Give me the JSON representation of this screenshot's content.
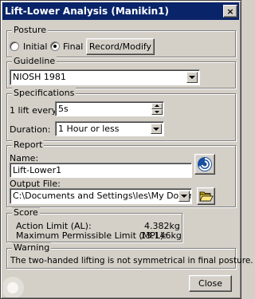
{
  "window": {
    "title": "Lift-Lower Analysis (Manikin1)",
    "close_glyph": "×"
  },
  "posture": {
    "group_label": "Posture",
    "options": [
      {
        "label": "Initial",
        "selected": false
      },
      {
        "label": "Final",
        "selected": true
      }
    ],
    "record_button": "Record/Modify"
  },
  "guideline": {
    "group_label": "Guideline",
    "selected": "NIOSH 1981"
  },
  "specifications": {
    "group_label": "Specifications",
    "lift_every_label": "1 lift every:",
    "lift_every_value": "5s",
    "duration_label": "Duration:",
    "duration_value": "1 Hour or less"
  },
  "report": {
    "group_label": "Report",
    "name_label": "Name:",
    "name_value": "Lift-Lower1",
    "output_file_label": "Output File:",
    "output_file_value": "C:\\Documents and Settings\\les\\My Docum",
    "icons": [
      "report-swirl-icon",
      "open-folder-icon"
    ]
  },
  "score": {
    "group_label": "Score",
    "rows": [
      {
        "label": "Action Limit (AL):",
        "value": "4.382kg"
      },
      {
        "label": "Maximum Permissible Limit (MPL):",
        "value": "13.146kg"
      }
    ]
  },
  "warning": {
    "group_label": "Warning",
    "message": "The two-handed lifting is not symmetrical in final posture."
  },
  "footer": {
    "close_button": "Close"
  }
}
